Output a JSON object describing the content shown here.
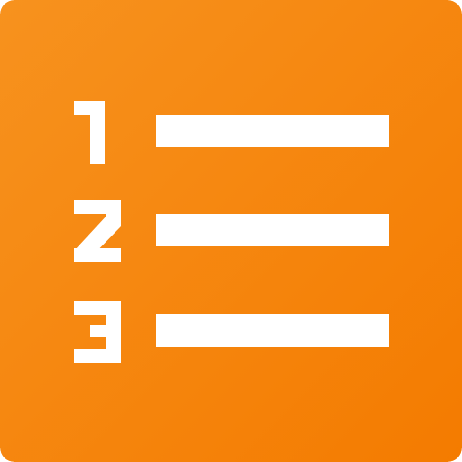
{
  "icon": {
    "name": "numbered-list-icon",
    "gradient_start": "#F7921E",
    "gradient_end": "#F47B00",
    "glyph_color": "#FFFFFF",
    "numbers": [
      "1",
      "2",
      "3"
    ],
    "rows": 3
  }
}
